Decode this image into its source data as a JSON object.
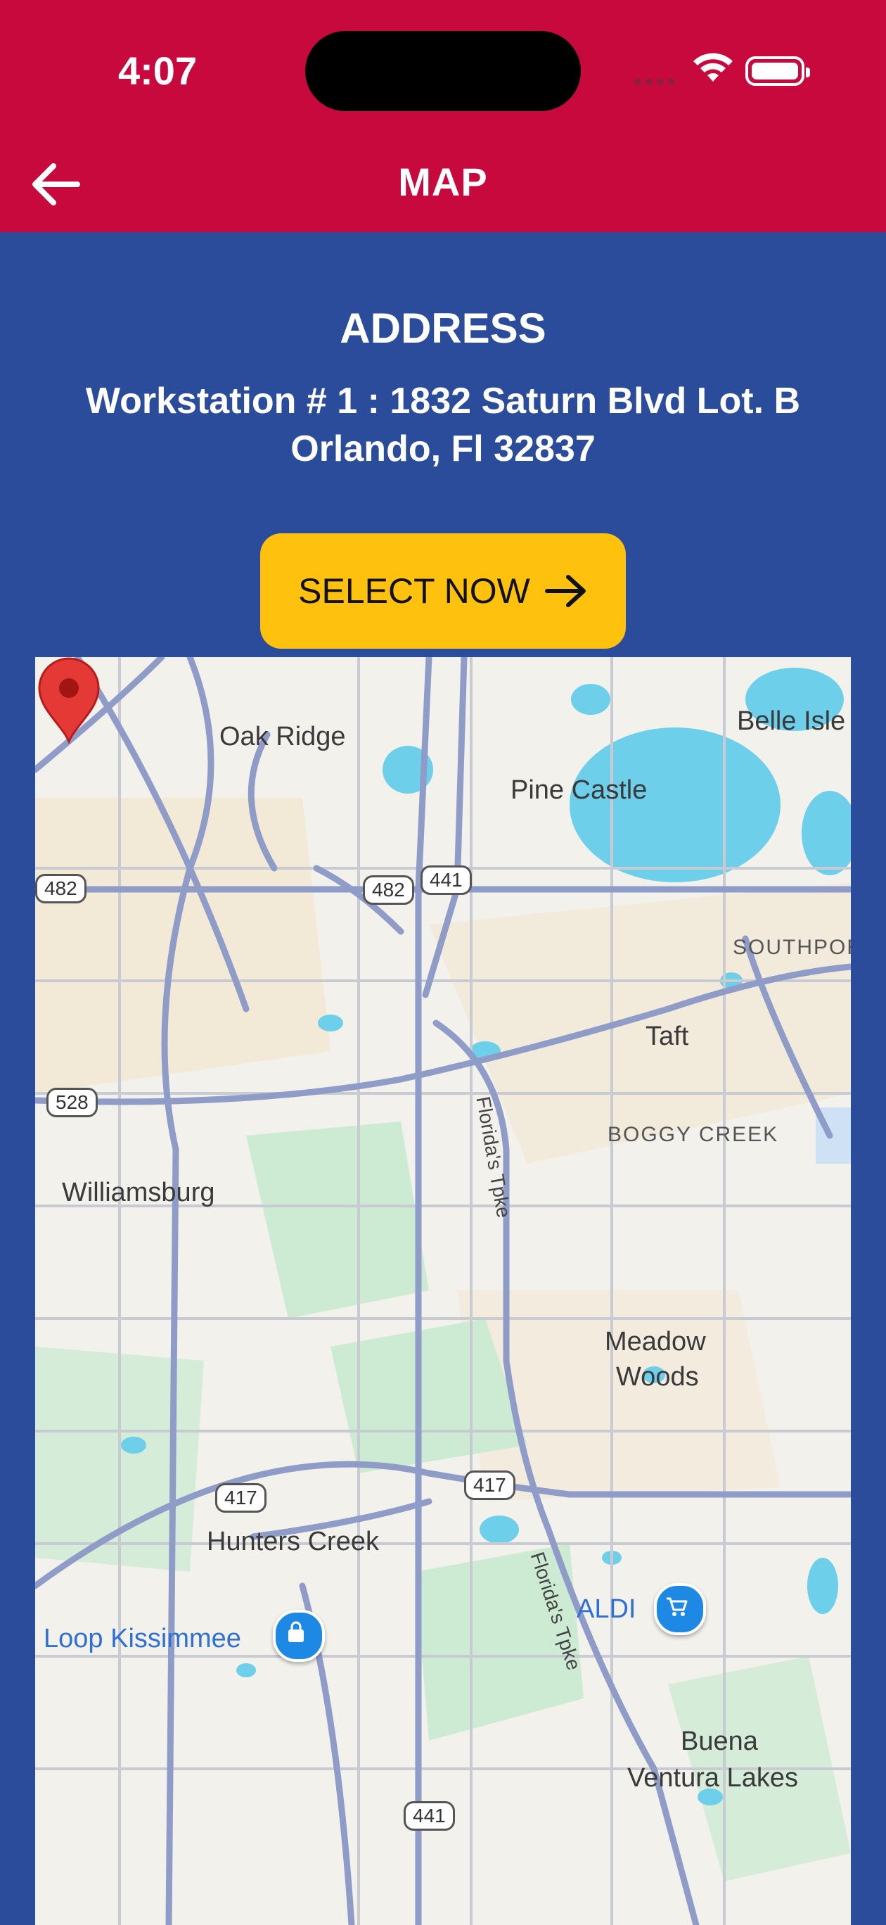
{
  "status_bar": {
    "time": "4:07"
  },
  "header": {
    "title": "MAP"
  },
  "address": {
    "heading": "ADDRESS",
    "line1": "Workstation # 1 : 1832 Saturn Blvd Lot. B",
    "line2": "Orlando, Fl 32837"
  },
  "select_button": {
    "label": "SELECT NOW"
  },
  "map": {
    "places": {
      "oak_ridge": "Oak Ridge",
      "pine_castle": "Pine Castle",
      "belle_isle": "Belle Isle",
      "southport": "SOUTHPOR",
      "taft": "Taft",
      "boggy_creek": "BOGGY CREEK",
      "williamsburg": "Williamsburg",
      "meadow_woods_1": "Meadow",
      "meadow_woods_2": "Woods",
      "hunters_creek": "Hunters Creek",
      "loop_kissimmee": "Loop Kissimmee",
      "aldi": "ALDI",
      "buena_1": "Buena",
      "buena_2": "Ventura Lakes"
    },
    "roads": {
      "r482a": "482",
      "r482b": "482",
      "r441a": "441",
      "r528": "528",
      "r417a": "417",
      "r417b": "417",
      "r441b": "441",
      "tpke1": "Florida's Tpke",
      "tpke2": "Florida's Tpke"
    },
    "colors": {
      "water": "#6ECFEA",
      "park": "#CDEBD3",
      "road": "#8E9CC7",
      "urban": "#F1E6CF"
    }
  }
}
